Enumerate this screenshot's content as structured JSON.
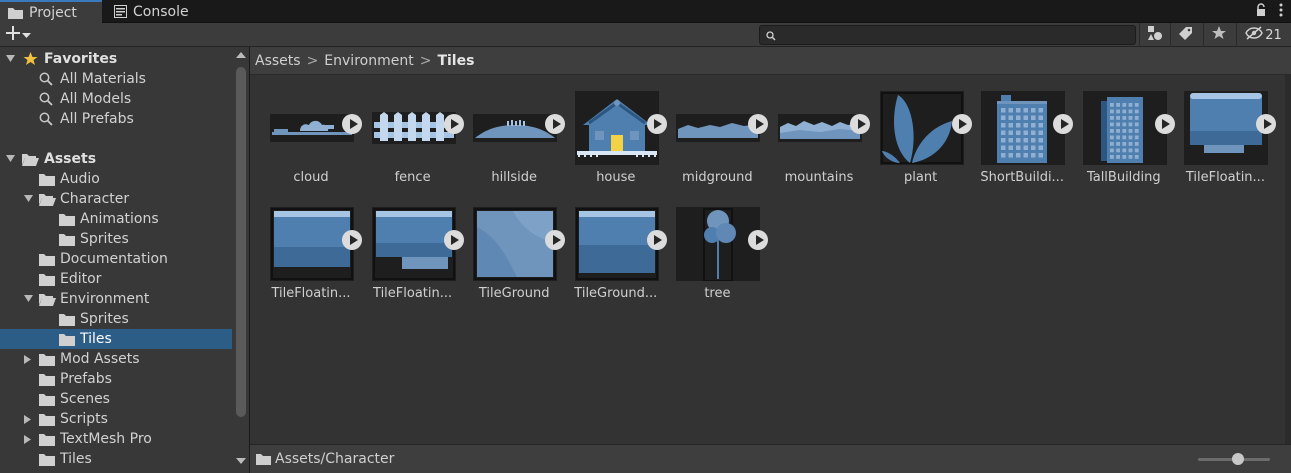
{
  "tabs": [
    {
      "label": "Project",
      "icon": "folder-icon",
      "active": true
    },
    {
      "label": "Console",
      "icon": "console-icon",
      "active": false
    }
  ],
  "toolbar": {
    "add_label": "+",
    "search_placeholder": "",
    "hidden_count": "21"
  },
  "tree": {
    "favorites_label": "Favorites",
    "favorites": [
      "All Materials",
      "All Models",
      "All Prefabs"
    ],
    "assets_label": "Assets",
    "folders": [
      {
        "label": "Audio",
        "depth": 1,
        "expander": "none"
      },
      {
        "label": "Character",
        "depth": 1,
        "expander": "open"
      },
      {
        "label": "Animations",
        "depth": 2,
        "expander": "none"
      },
      {
        "label": "Sprites",
        "depth": 2,
        "expander": "none"
      },
      {
        "label": "Documentation",
        "depth": 1,
        "expander": "none"
      },
      {
        "label": "Editor",
        "depth": 1,
        "expander": "none"
      },
      {
        "label": "Environment",
        "depth": 1,
        "expander": "open"
      },
      {
        "label": "Sprites",
        "depth": 2,
        "expander": "none"
      },
      {
        "label": "Tiles",
        "depth": 2,
        "expander": "none",
        "selected": true
      },
      {
        "label": "Mod Assets",
        "depth": 1,
        "expander": "closed"
      },
      {
        "label": "Prefabs",
        "depth": 1,
        "expander": "none"
      },
      {
        "label": "Scenes",
        "depth": 1,
        "expander": "none"
      },
      {
        "label": "Scripts",
        "depth": 1,
        "expander": "closed"
      },
      {
        "label": "TextMesh Pro",
        "depth": 1,
        "expander": "closed"
      },
      {
        "label": "Tiles",
        "depth": 1,
        "expander": "none"
      }
    ]
  },
  "breadcrumb": {
    "items": [
      "Assets",
      "Environment"
    ],
    "current": "Tiles",
    "separator": ">"
  },
  "assets": [
    {
      "label": "cloud",
      "thumb": "cloud"
    },
    {
      "label": "fence",
      "thumb": "fence"
    },
    {
      "label": "hillside",
      "thumb": "hillside"
    },
    {
      "label": "house",
      "thumb": "house"
    },
    {
      "label": "midground",
      "thumb": "midground"
    },
    {
      "label": "mountains",
      "thumb": "mountains"
    },
    {
      "label": "plant",
      "thumb": "plant"
    },
    {
      "label": "ShortBuildi...",
      "thumb": "shortbuilding"
    },
    {
      "label": "TallBuilding",
      "thumb": "tallbuilding"
    },
    {
      "label": "TileFloatin...",
      "thumb": "tilefloating"
    },
    {
      "label": "TileFloatin...",
      "thumb": "tilefloating2"
    },
    {
      "label": "TileFloatin...",
      "thumb": "tilefloating3"
    },
    {
      "label": "TileGround",
      "thumb": "tileground"
    },
    {
      "label": "TileGround...",
      "thumb": "tileground2"
    },
    {
      "label": "tree",
      "thumb": "tree"
    }
  ],
  "status": {
    "path": "Assets/Character",
    "zoom_level": 0.55
  },
  "colors": {
    "accent": "#3a79bb",
    "selection": "#2c5d87",
    "thumb_blue": "#4f7fae"
  }
}
